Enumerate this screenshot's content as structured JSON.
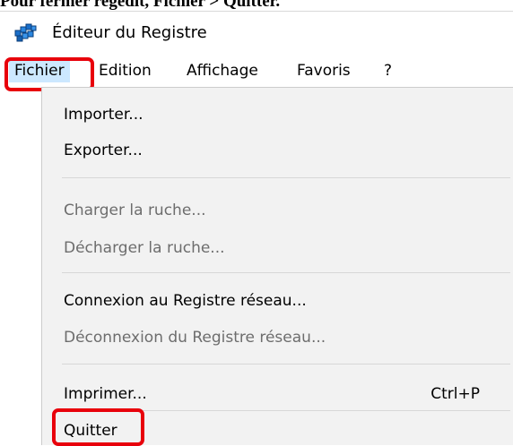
{
  "caption": "Pour fermer regedit, Fichier > Quitter.",
  "window": {
    "title": "Éditeur du Registre",
    "icon": "registry-editor-icon"
  },
  "menubar": {
    "items": [
      "Fichier",
      "Edition",
      "Affichage",
      "Favoris",
      "?"
    ],
    "active": "Fichier"
  },
  "file_menu": {
    "import": "Importer...",
    "export": "Exporter...",
    "load_hive": "Charger la ruche...",
    "unload_hive": "Décharger la ruche...",
    "connect_network": "Connexion au Registre réseau...",
    "disconnect_network": "Déconnexion du Registre réseau...",
    "print": "Imprimer...",
    "print_shortcut": "Ctrl+P",
    "quit": "Quitter"
  },
  "colors": {
    "highlight": "#e8000b",
    "menu_background": "#f2f2f2",
    "active_menu": "#cce8ff",
    "disabled_text": "#6d6d6d"
  }
}
